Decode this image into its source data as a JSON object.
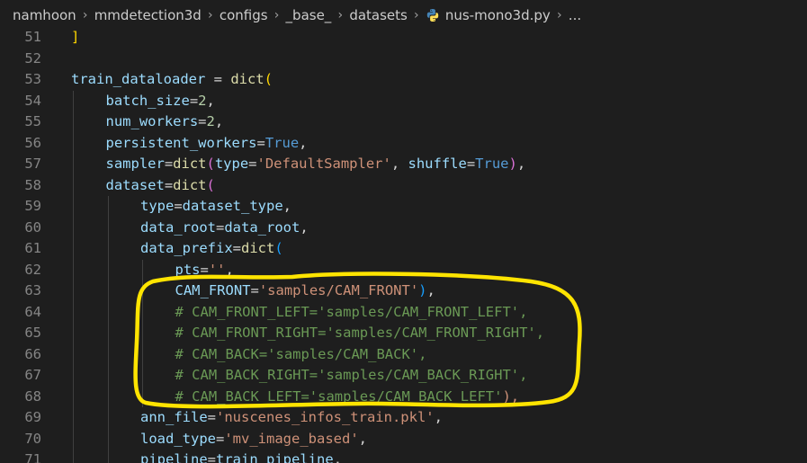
{
  "breadcrumb": {
    "items": [
      "namhoon",
      "mmdetection3d",
      "configs",
      "_base_",
      "datasets"
    ],
    "file": "nus-mono3d.py",
    "ellipsis": "..."
  },
  "lines": [
    {
      "n": "51",
      "indent": 0,
      "tokens": [
        {
          "t": "]",
          "c": "p1"
        }
      ]
    },
    {
      "n": "52",
      "indent": 0,
      "tokens": []
    },
    {
      "n": "53",
      "indent": 0,
      "tokens": [
        {
          "t": "train_dataloader",
          "c": "var"
        },
        {
          "t": " = ",
          "c": "op"
        },
        {
          "t": "dict",
          "c": "fn"
        },
        {
          "t": "(",
          "c": "p1"
        }
      ]
    },
    {
      "n": "54",
      "indent": 1,
      "tokens": [
        {
          "t": "batch_size",
          "c": "var"
        },
        {
          "t": "=",
          "c": "op"
        },
        {
          "t": "2",
          "c": "num"
        },
        {
          "t": ",",
          "c": "op"
        }
      ]
    },
    {
      "n": "55",
      "indent": 1,
      "tokens": [
        {
          "t": "num_workers",
          "c": "var"
        },
        {
          "t": "=",
          "c": "op"
        },
        {
          "t": "2",
          "c": "num"
        },
        {
          "t": ",",
          "c": "op"
        }
      ]
    },
    {
      "n": "56",
      "indent": 1,
      "tokens": [
        {
          "t": "persistent_workers",
          "c": "var"
        },
        {
          "t": "=",
          "c": "op"
        },
        {
          "t": "True",
          "c": "kw"
        },
        {
          "t": ",",
          "c": "op"
        }
      ]
    },
    {
      "n": "57",
      "indent": 1,
      "tokens": [
        {
          "t": "sampler",
          "c": "var"
        },
        {
          "t": "=",
          "c": "op"
        },
        {
          "t": "dict",
          "c": "fn"
        },
        {
          "t": "(",
          "c": "p2"
        },
        {
          "t": "type",
          "c": "var"
        },
        {
          "t": "=",
          "c": "op"
        },
        {
          "t": "'DefaultSampler'",
          "c": "str"
        },
        {
          "t": ", ",
          "c": "op"
        },
        {
          "t": "shuffle",
          "c": "var"
        },
        {
          "t": "=",
          "c": "op"
        },
        {
          "t": "True",
          "c": "kw"
        },
        {
          "t": ")",
          "c": "p2"
        },
        {
          "t": ",",
          "c": "op"
        }
      ]
    },
    {
      "n": "58",
      "indent": 1,
      "tokens": [
        {
          "t": "dataset",
          "c": "var"
        },
        {
          "t": "=",
          "c": "op"
        },
        {
          "t": "dict",
          "c": "fn"
        },
        {
          "t": "(",
          "c": "p2"
        }
      ]
    },
    {
      "n": "59",
      "indent": 2,
      "tokens": [
        {
          "t": "type",
          "c": "var"
        },
        {
          "t": "=",
          "c": "op"
        },
        {
          "t": "dataset_type",
          "c": "var"
        },
        {
          "t": ",",
          "c": "op"
        }
      ]
    },
    {
      "n": "60",
      "indent": 2,
      "tokens": [
        {
          "t": "data_root",
          "c": "var"
        },
        {
          "t": "=",
          "c": "op"
        },
        {
          "t": "data_root",
          "c": "var"
        },
        {
          "t": ",",
          "c": "op"
        }
      ]
    },
    {
      "n": "61",
      "indent": 2,
      "tokens": [
        {
          "t": "data_prefix",
          "c": "var"
        },
        {
          "t": "=",
          "c": "op"
        },
        {
          "t": "dict",
          "c": "fn"
        },
        {
          "t": "(",
          "c": "p3"
        }
      ]
    },
    {
      "n": "62",
      "indent": 3,
      "tokens": [
        {
          "t": "pts",
          "c": "var"
        },
        {
          "t": "=",
          "c": "op"
        },
        {
          "t": "''",
          "c": "str"
        },
        {
          "t": ",",
          "c": "op"
        }
      ]
    },
    {
      "n": "63",
      "indent": 3,
      "tokens": [
        {
          "t": "CAM_FRONT",
          "c": "var"
        },
        {
          "t": "=",
          "c": "op"
        },
        {
          "t": "'samples/CAM_FRONT'",
          "c": "str"
        },
        {
          "t": ")",
          "c": "p3"
        },
        {
          "t": ",",
          "c": "op"
        }
      ]
    },
    {
      "n": "64",
      "indent": 3,
      "tokens": [
        {
          "t": "# CAM_FRONT_LEFT='samples/CAM_FRONT_LEFT',",
          "c": "cmt"
        }
      ]
    },
    {
      "n": "65",
      "indent": 3,
      "tokens": [
        {
          "t": "# CAM_FRONT_RIGHT='samples/CAM_FRONT_RIGHT',",
          "c": "cmt"
        }
      ]
    },
    {
      "n": "66",
      "indent": 3,
      "tokens": [
        {
          "t": "# CAM_BACK='samples/CAM_BACK',",
          "c": "cmt"
        }
      ]
    },
    {
      "n": "67",
      "indent": 3,
      "tokens": [
        {
          "t": "# CAM_BACK_RIGHT='samples/CAM_BACK_RIGHT',",
          "c": "cmt"
        }
      ]
    },
    {
      "n": "68",
      "indent": 3,
      "tokens": [
        {
          "t": "# CAM_BACK_LEFT='samples/CAM_BACK_LEFT'",
          "c": "cmt"
        },
        {
          "t": "),",
          "c": "str"
        }
      ]
    },
    {
      "n": "69",
      "indent": 2,
      "tokens": [
        {
          "t": "ann_file",
          "c": "var"
        },
        {
          "t": "=",
          "c": "op"
        },
        {
          "t": "'nuscenes_infos_train.pkl'",
          "c": "str"
        },
        {
          "t": ",",
          "c": "op"
        }
      ]
    },
    {
      "n": "70",
      "indent": 2,
      "tokens": [
        {
          "t": "load_type",
          "c": "var"
        },
        {
          "t": "=",
          "c": "op"
        },
        {
          "t": "'mv_image_based'",
          "c": "str"
        },
        {
          "t": ",",
          "c": "op"
        }
      ]
    },
    {
      "n": "71",
      "indent": 2,
      "tokens": [
        {
          "t": "pipeline",
          "c": "var"
        },
        {
          "t": "=",
          "c": "op"
        },
        {
          "t": "train_pipeline",
          "c": "var"
        },
        {
          "t": ",",
          "c": "op"
        }
      ]
    }
  ],
  "colors": {
    "background": "#1e1e1e",
    "annotation": "#ffe400"
  },
  "icons": {
    "file": "python-file-icon",
    "separator": "chevron-right-icon"
  }
}
